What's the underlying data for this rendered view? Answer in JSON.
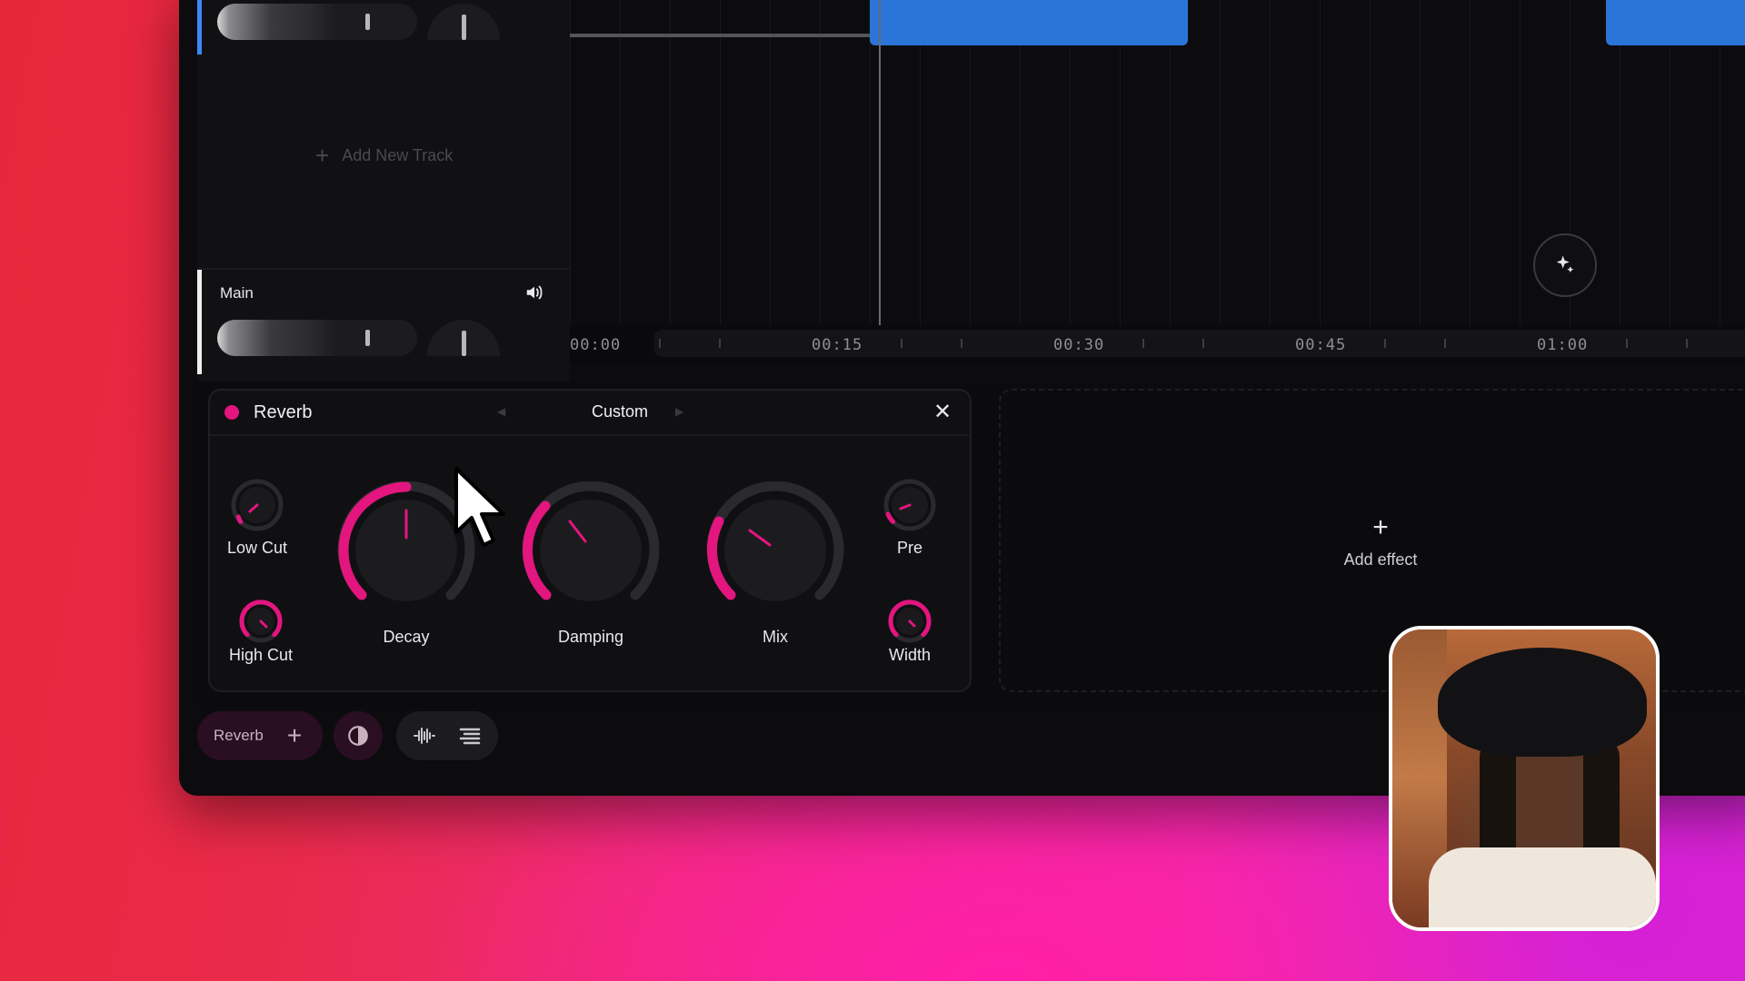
{
  "tracks": {
    "add_new_track_label": "Add New Track",
    "main_label": "Main"
  },
  "timeline": {
    "ruler_labels": [
      "00:00",
      "00:15",
      "00:30",
      "00:45",
      "01:00"
    ]
  },
  "effect_card": {
    "name": "Reverb",
    "preset": "Custom",
    "knobs": {
      "low_cut": "Low Cut",
      "high_cut": "High Cut",
      "decay": "Decay",
      "damping": "Damping",
      "mix": "Mix",
      "pre": "Pre",
      "width": "Width"
    },
    "accent_color": "#e3157f"
  },
  "add_effect": {
    "label": "Add effect"
  },
  "toolbar": {
    "effect_pill_label": "Reverb"
  },
  "colors": {
    "clip_blue": "#2b74d8",
    "window_bg": "#0c0c0e"
  }
}
